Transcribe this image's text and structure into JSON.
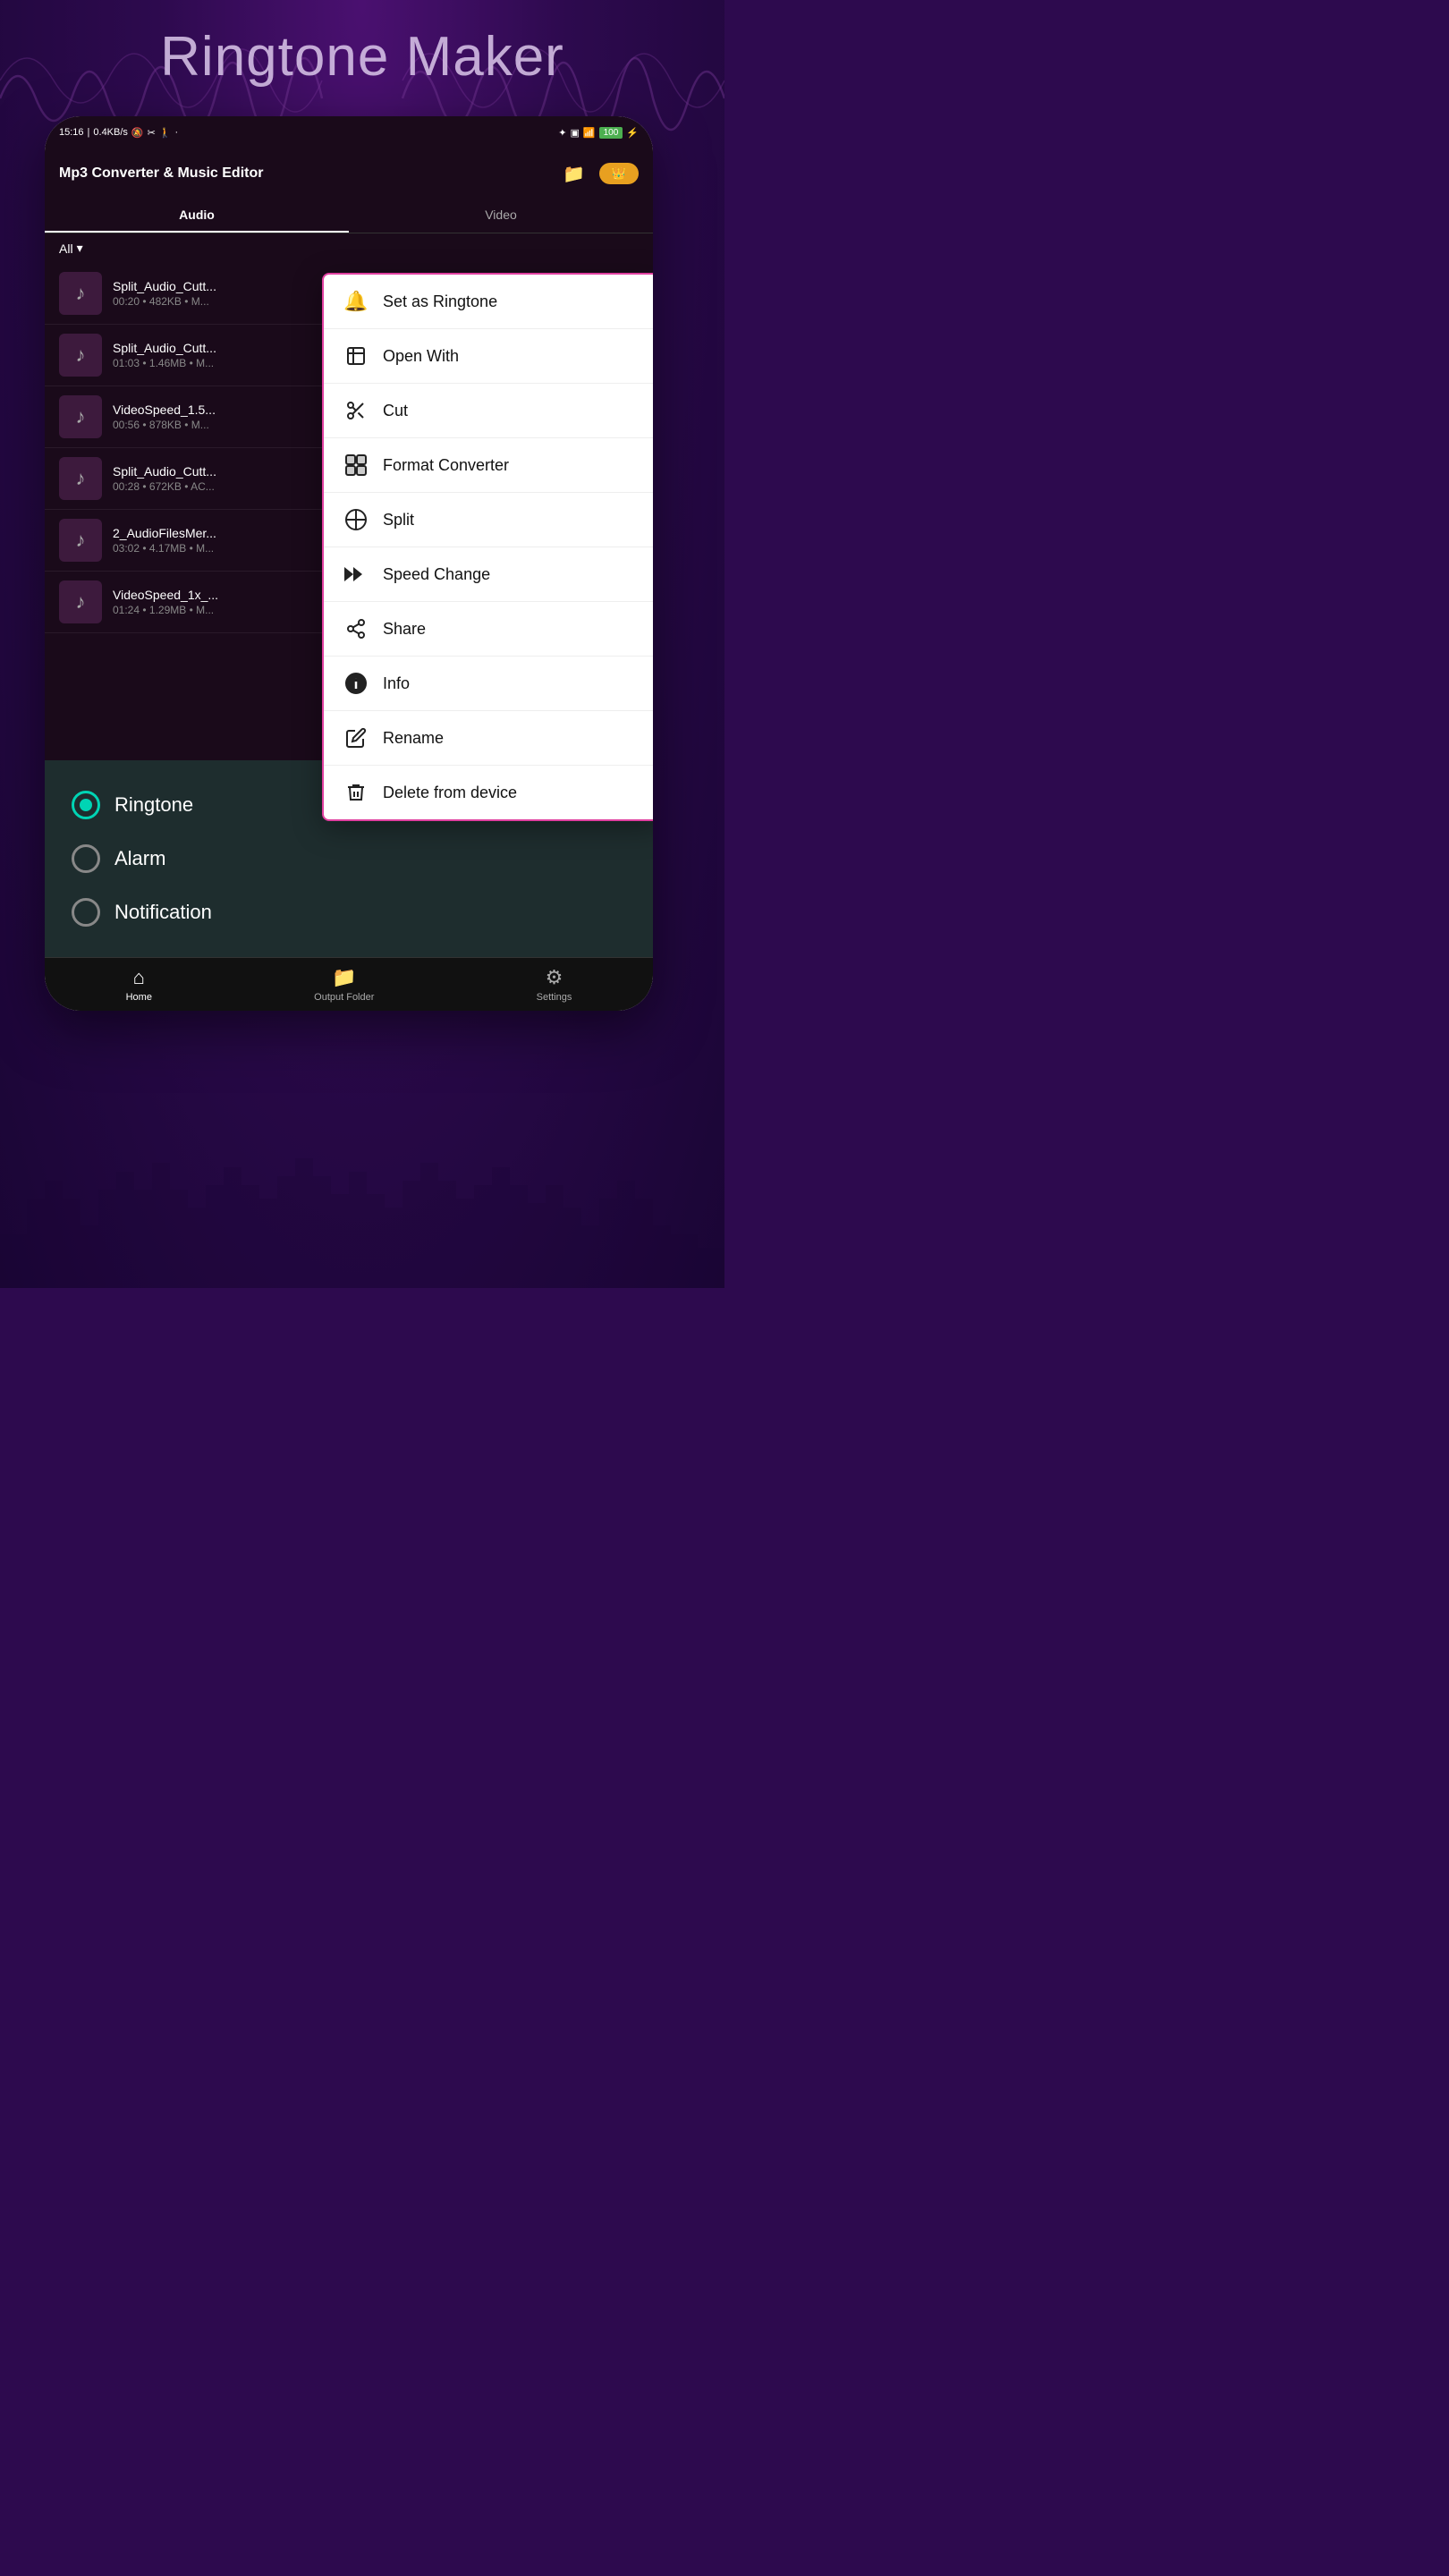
{
  "app": {
    "title": "Ringtone Maker",
    "bg_color": "#2d0a4e"
  },
  "status_bar": {
    "time": "15:16",
    "data_speed": "0.4KB/s",
    "battery": "100"
  },
  "phone_header": {
    "title": "Mp3 Converter & Music Editor",
    "folder_icon": "📁",
    "premium_label": "👑"
  },
  "tabs": [
    {
      "label": "Audio",
      "active": true
    },
    {
      "label": "Video",
      "active": false
    }
  ],
  "filter": {
    "label": "All",
    "icon": "▾"
  },
  "audio_items": [
    {
      "name": "Split_Audio_Cutt...",
      "meta": "00:20 • 482KB • M..."
    },
    {
      "name": "Split_Audio_Cutt...",
      "meta": "01:03 • 1.46MB • M..."
    },
    {
      "name": "VideoSpeed_1.5...",
      "meta": "00:56 • 878KB • M..."
    },
    {
      "name": "Split_Audio_Cutt...",
      "meta": "00:28 • 672KB • AC..."
    },
    {
      "name": "2_AudioFilesMer...",
      "meta": "03:02 • 4.17MB • M..."
    },
    {
      "name": "VideoSpeed_1x_...",
      "meta": "01:24 • 1.29MB • M..."
    }
  ],
  "context_menu": {
    "items": [
      {
        "id": "set-ringtone",
        "icon": "🔔",
        "label": "Set as Ringtone"
      },
      {
        "id": "open-with",
        "icon": "↗",
        "label": "Open With"
      },
      {
        "id": "cut",
        "icon": "✂",
        "label": "Cut"
      },
      {
        "id": "format-converter",
        "icon": "⊞",
        "label": "Format Converter"
      },
      {
        "id": "split",
        "icon": "⊕",
        "label": "Split"
      },
      {
        "id": "speed-change",
        "icon": "▶▶",
        "label": "Speed Change"
      },
      {
        "id": "share",
        "icon": "⋌",
        "label": "Share"
      },
      {
        "id": "info",
        "icon": "ℹ",
        "label": "Info"
      },
      {
        "id": "rename",
        "icon": "✏",
        "label": "Rename"
      },
      {
        "id": "delete",
        "icon": "🗑",
        "label": "Delete from device"
      }
    ]
  },
  "ringtone_options": [
    {
      "id": "ringtone",
      "label": "Ringtone",
      "selected": true
    },
    {
      "id": "alarm",
      "label": "Alarm",
      "selected": false
    },
    {
      "id": "notification",
      "label": "Notification",
      "selected": false
    }
  ],
  "bottom_nav": [
    {
      "id": "home",
      "icon": "⌂",
      "label": "Home",
      "active": true
    },
    {
      "id": "output-folder",
      "icon": "📁",
      "label": "Output Folder",
      "active": false
    },
    {
      "id": "settings",
      "icon": "⚙",
      "label": "Settings",
      "active": false
    }
  ]
}
